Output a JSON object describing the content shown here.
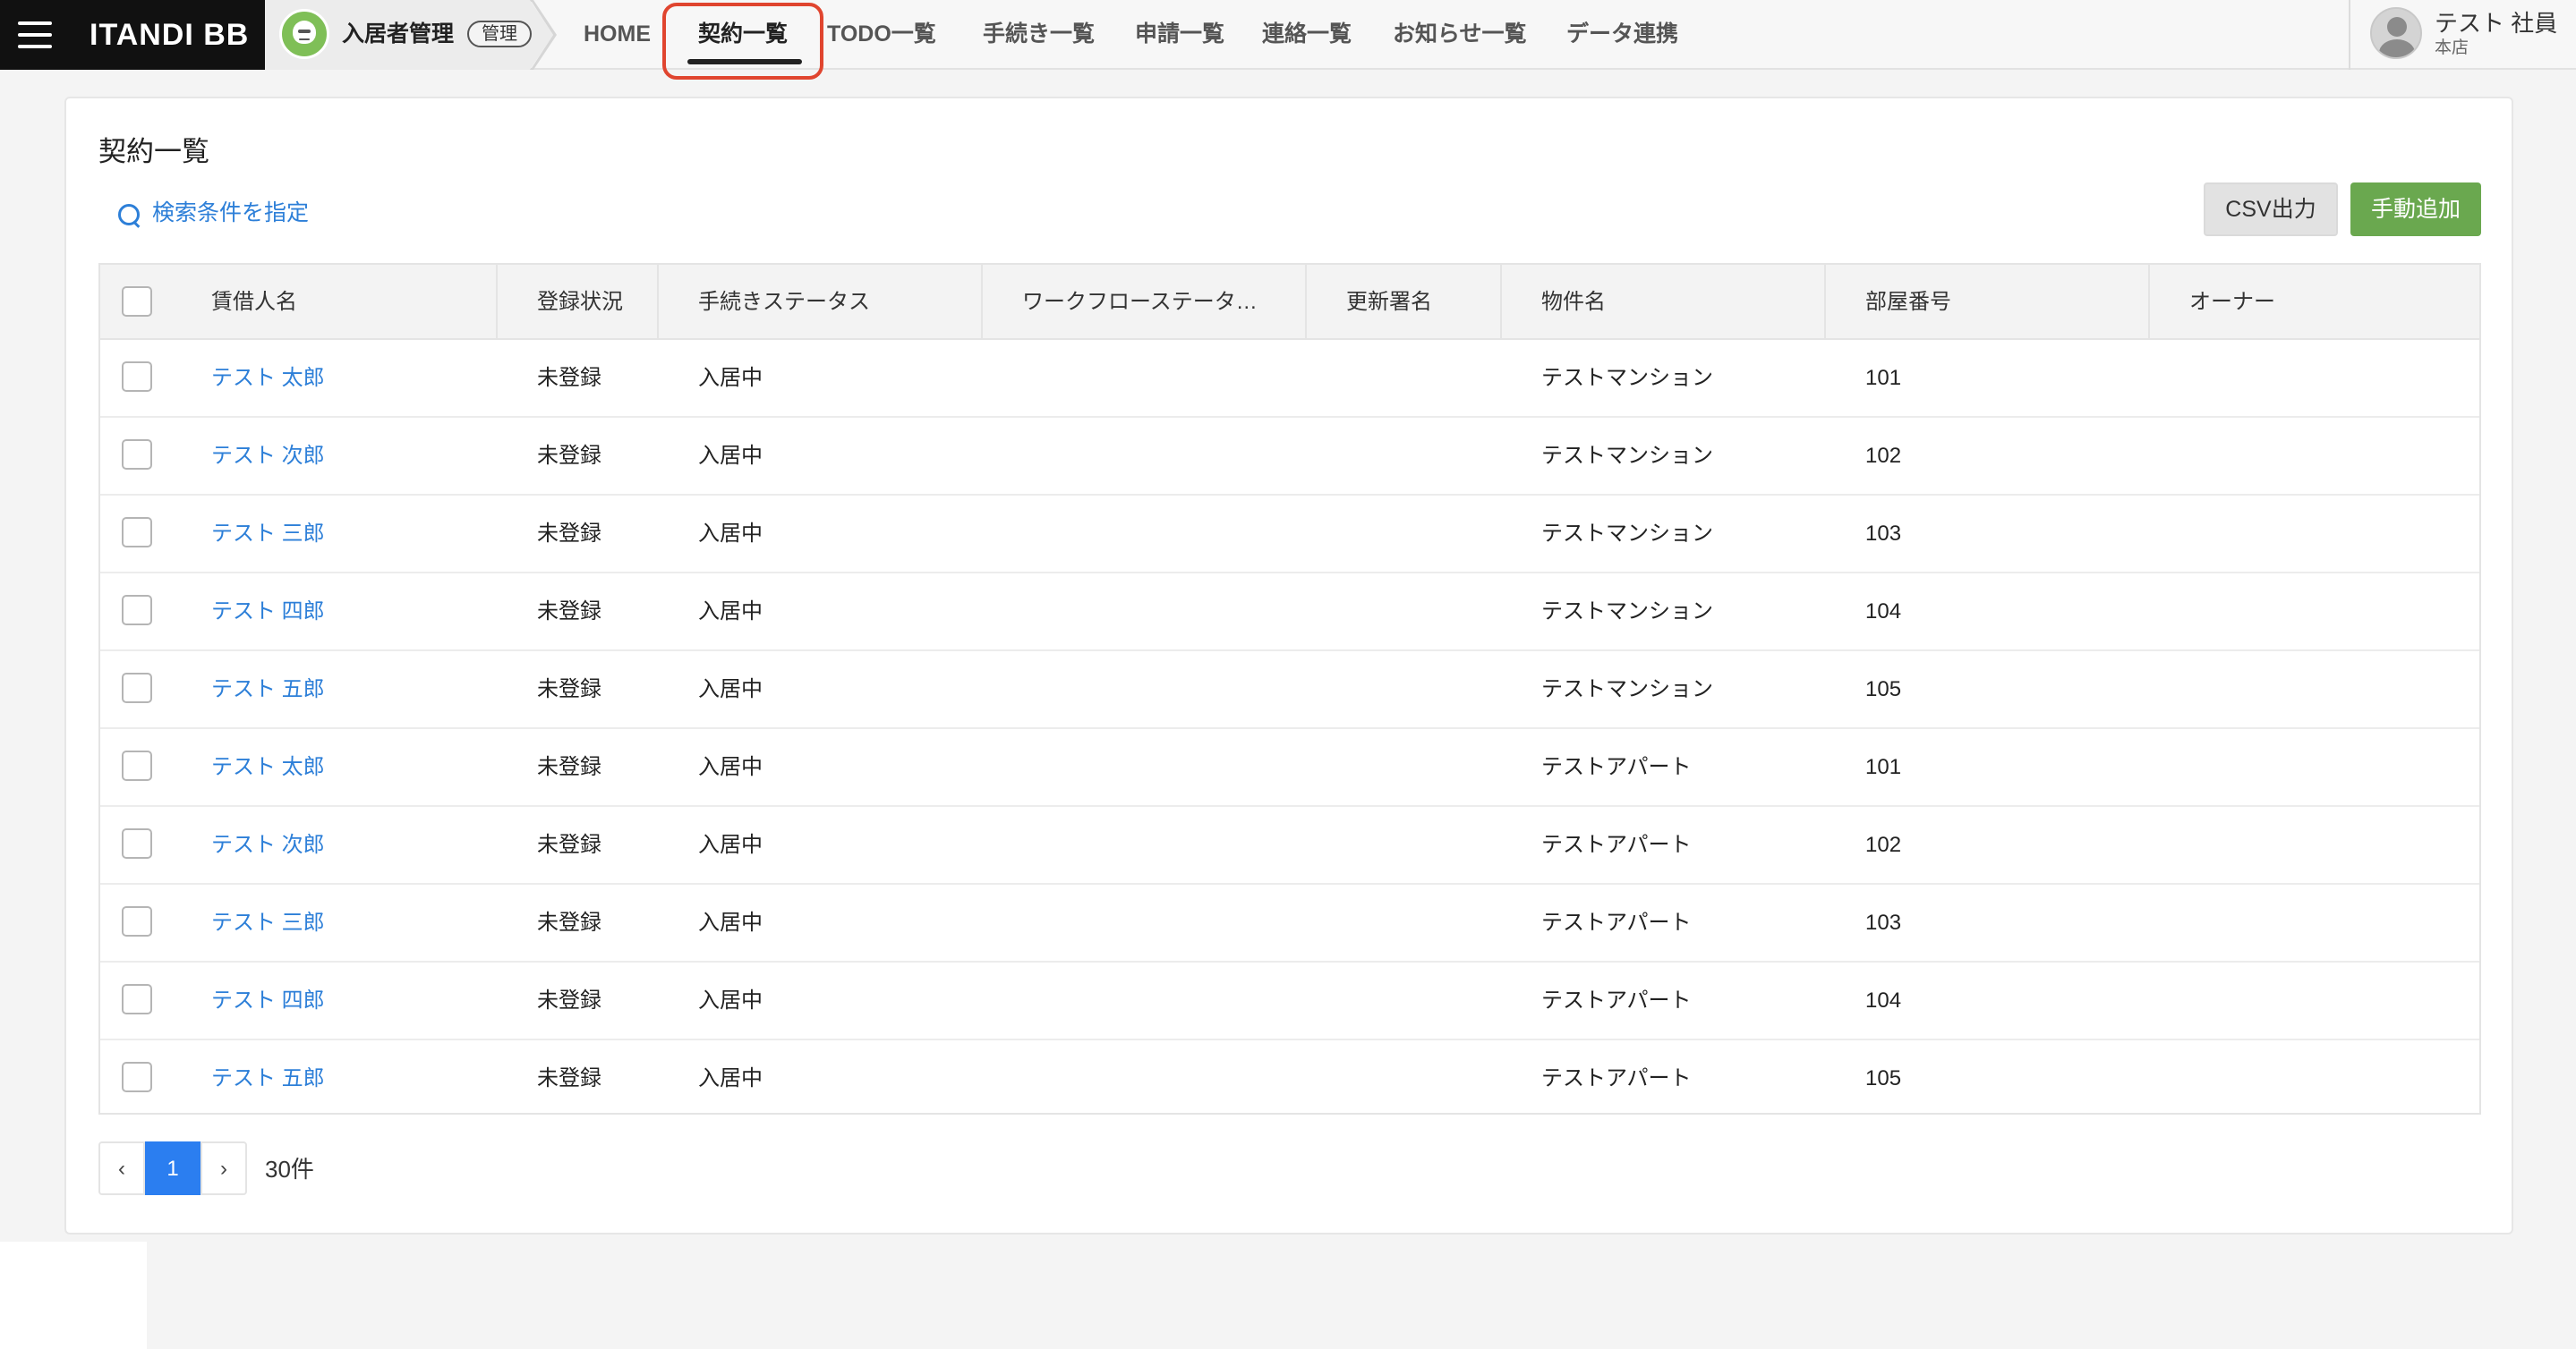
{
  "header": {
    "brand": "ITANDI BB",
    "app_name": "入居者管理",
    "app_badge": "管理",
    "nav": [
      {
        "label": "HOME"
      },
      {
        "label": "契約一覧"
      },
      {
        "label": "TODO一覧"
      },
      {
        "label": "手続き一覧"
      },
      {
        "label": "申請一覧"
      },
      {
        "label": "連絡一覧"
      },
      {
        "label": "お知らせ一覧"
      },
      {
        "label": "データ連携"
      }
    ],
    "active_nav": "契約一覧",
    "user": {
      "name": "テスト 社員",
      "branch": "本店"
    }
  },
  "page": {
    "title": "契約一覧",
    "search_link": "検索条件を指定",
    "csv_button": "CSV出力",
    "add_button": "手動追加"
  },
  "table": {
    "columns": [
      "賃借人名",
      "登録状況",
      "手続きステータス",
      "ワークフローステータ…",
      "更新署名",
      "物件名",
      "部屋番号",
      "オーナー"
    ],
    "rows": [
      {
        "tenant": "テスト 太郎",
        "registration": "未登録",
        "procedure_status": "入居中",
        "workflow_status": "",
        "renewal_signature": "",
        "property": "テストマンション",
        "room": "101",
        "owner": ""
      },
      {
        "tenant": "テスト 次郎",
        "registration": "未登録",
        "procedure_status": "入居中",
        "workflow_status": "",
        "renewal_signature": "",
        "property": "テストマンション",
        "room": "102",
        "owner": ""
      },
      {
        "tenant": "テスト 三郎",
        "registration": "未登録",
        "procedure_status": "入居中",
        "workflow_status": "",
        "renewal_signature": "",
        "property": "テストマンション",
        "room": "103",
        "owner": ""
      },
      {
        "tenant": "テスト 四郎",
        "registration": "未登録",
        "procedure_status": "入居中",
        "workflow_status": "",
        "renewal_signature": "",
        "property": "テストマンション",
        "room": "104",
        "owner": ""
      },
      {
        "tenant": "テスト 五郎",
        "registration": "未登録",
        "procedure_status": "入居中",
        "workflow_status": "",
        "renewal_signature": "",
        "property": "テストマンション",
        "room": "105",
        "owner": ""
      },
      {
        "tenant": "テスト 太郎",
        "registration": "未登録",
        "procedure_status": "入居中",
        "workflow_status": "",
        "renewal_signature": "",
        "property": "テストアパート",
        "room": "101",
        "owner": ""
      },
      {
        "tenant": "テスト 次郎",
        "registration": "未登録",
        "procedure_status": "入居中",
        "workflow_status": "",
        "renewal_signature": "",
        "property": "テストアパート",
        "room": "102",
        "owner": ""
      },
      {
        "tenant": "テスト 三郎",
        "registration": "未登録",
        "procedure_status": "入居中",
        "workflow_status": "",
        "renewal_signature": "",
        "property": "テストアパート",
        "room": "103",
        "owner": ""
      },
      {
        "tenant": "テスト 四郎",
        "registration": "未登録",
        "procedure_status": "入居中",
        "workflow_status": "",
        "renewal_signature": "",
        "property": "テストアパート",
        "room": "104",
        "owner": ""
      },
      {
        "tenant": "テスト 五郎",
        "registration": "未登録",
        "procedure_status": "入居中",
        "workflow_status": "",
        "renewal_signature": "",
        "property": "テストアパート",
        "room": "105",
        "owner": ""
      }
    ]
  },
  "pagination": {
    "prev": "‹",
    "current_page": "1",
    "next": "›",
    "total": "30件"
  },
  "colors": {
    "link": "#2d7fd8",
    "primary_button": "#6aa84f",
    "active_page": "#2b7ef0",
    "highlight": "#e0452f"
  }
}
